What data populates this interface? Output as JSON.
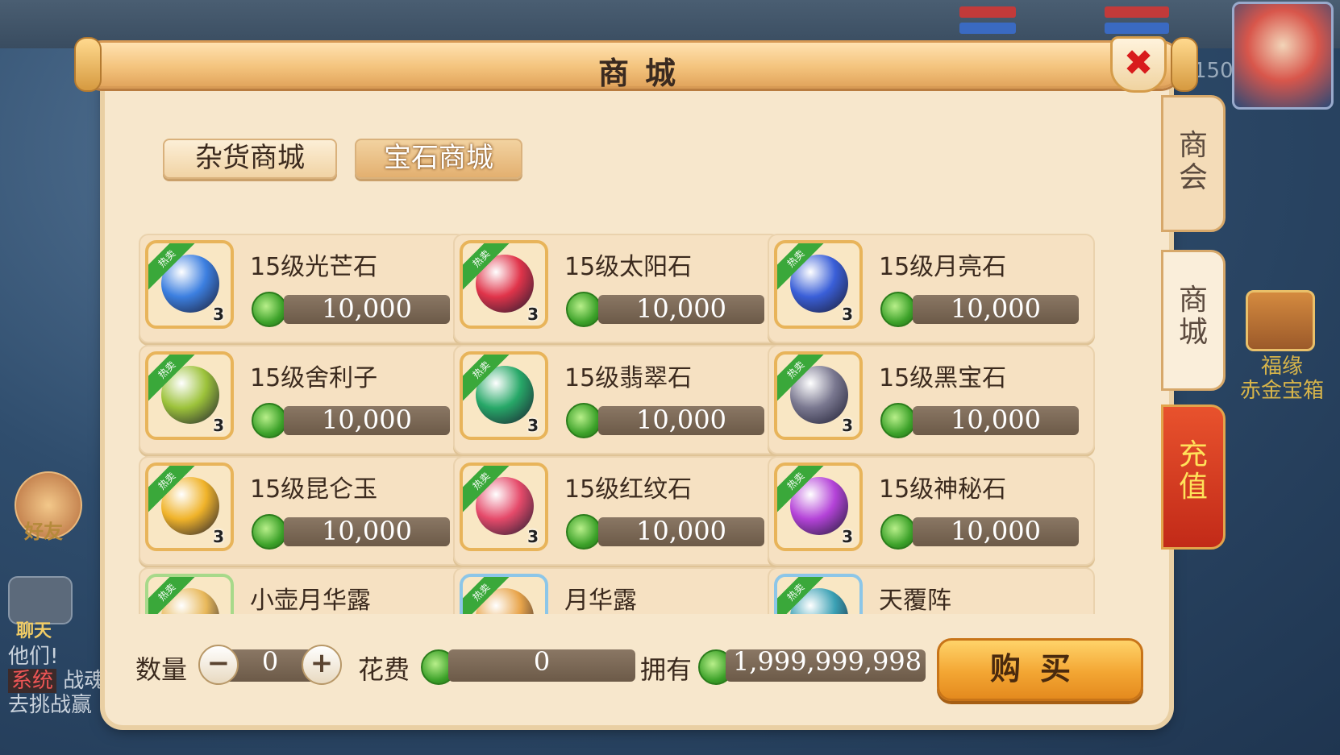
{
  "background": {
    "level": "150",
    "friend_label": "好友",
    "chat_label": "聊天",
    "sys_lines": [
      "他们!",
      "战魂",
      "去挑战赢"
    ],
    "sys_tag": "系统",
    "chest_label_1": "福缘",
    "chest_label_2": "赤金宝箱"
  },
  "window": {
    "title": "商城",
    "close_icon": "close-icon"
  },
  "side_tabs": [
    {
      "label": "商会"
    },
    {
      "label": "商城"
    },
    {
      "label": "充值"
    }
  ],
  "category_tabs": [
    {
      "label": "杂货商城",
      "active": false
    },
    {
      "label": "宝石商城",
      "active": true
    }
  ],
  "hot_tag": "热卖",
  "items": [
    {
      "name": "15级光芒石",
      "price": "10,000",
      "qty": "3",
      "color": "#3c7fe0"
    },
    {
      "name": "15级太阳石",
      "price": "10,000",
      "qty": "3",
      "color": "#e0344a"
    },
    {
      "name": "15级月亮石",
      "price": "10,000",
      "qty": "3",
      "color": "#3a5fd8"
    },
    {
      "name": "15级舍利子",
      "price": "10,000",
      "qty": "3",
      "color": "#9cc23a"
    },
    {
      "name": "15级翡翠石",
      "price": "10,000",
      "qty": "3",
      "color": "#27a868"
    },
    {
      "name": "15级黑宝石",
      "price": "10,000",
      "qty": "3",
      "color": "#7a7890"
    },
    {
      "name": "15级昆仑玉",
      "price": "10,000",
      "qty": "3",
      "color": "#f0b32a"
    },
    {
      "name": "15级红纹石",
      "price": "10,000",
      "qty": "3",
      "color": "#e54a6a"
    },
    {
      "name": "15级神秘石",
      "price": "10,000",
      "qty": "3",
      "color": "#b443d8"
    },
    {
      "name": "小壶月华露",
      "price": "",
      "qty": "",
      "color": "#e8b85a"
    },
    {
      "name": "月华露",
      "price": "",
      "qty": "",
      "color": "#e8a44a"
    },
    {
      "name": "天覆阵",
      "price": "",
      "qty": "",
      "color": "#3aa0b4"
    }
  ],
  "bottom": {
    "quantity_label": "数量",
    "quantity_value": "0",
    "minus": "−",
    "plus": "+",
    "cost_label": "花费",
    "cost_value": "0",
    "own_label": "拥有",
    "own_value": "1,999,999,998",
    "buy_label": "购买"
  }
}
